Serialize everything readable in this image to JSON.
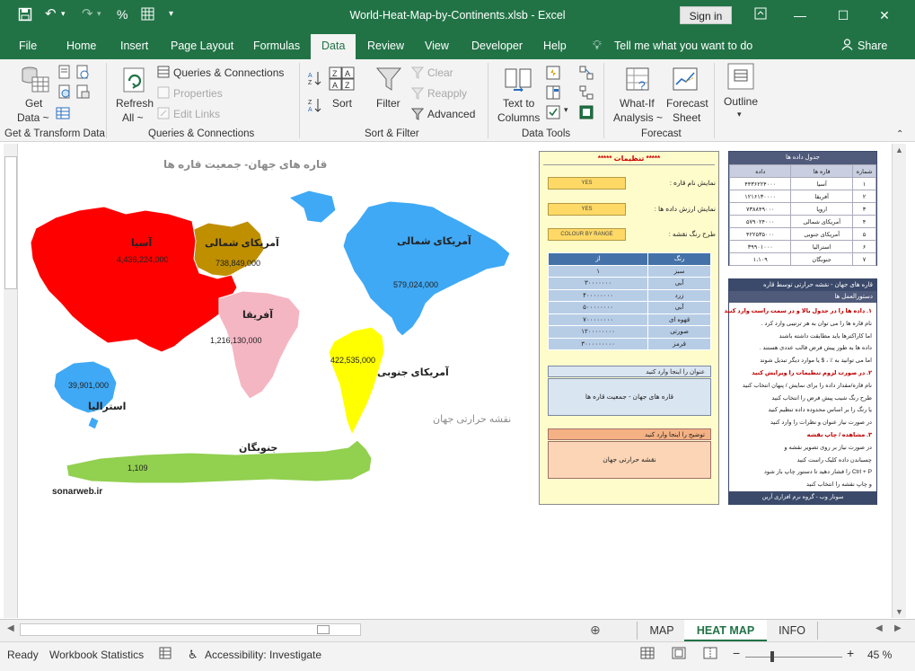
{
  "window": {
    "title": "World-Heat-Map-by-Continents.xlsb  -  Excel",
    "signin_label": "Sign in",
    "colors": {
      "excel_green": "#217346"
    }
  },
  "menu": {
    "tabs": [
      "File",
      "Home",
      "Insert",
      "Page Layout",
      "Formulas",
      "Data",
      "Review",
      "View",
      "Developer",
      "Help"
    ],
    "active_tab": "Data",
    "tell_me": "Tell me what you want to do",
    "share": "Share"
  },
  "ribbon": {
    "get_data": "Get\nData",
    "get_data_l1": "Get",
    "get_data_l2": "Data ~",
    "group_get_transform": "Get & Transform Data",
    "refresh_l1": "Refresh",
    "refresh_l2": "All ~",
    "queries_connections": "Queries & Connections",
    "properties": "Properties",
    "edit_links": "Edit Links",
    "group_queries": "Queries & Connections",
    "sort": "Sort",
    "filter": "Filter",
    "clear": "Clear",
    "reapply": "Reapply",
    "advanced": "Advanced",
    "group_sort_filter": "Sort & Filter",
    "text_to_columns_l1": "Text to",
    "text_to_columns_l2": "Columns",
    "group_data_tools": "Data Tools",
    "whatif_l1": "What-If",
    "whatif_l2": "Analysis ~",
    "forecast_l1": "Forecast",
    "forecast_l2": "Sheet",
    "group_forecast": "Forecast",
    "outline": "Outline"
  },
  "map": {
    "title": "قاره های جهان- جمعیت قاره ها",
    "subtitle": "نقشه حرارتی جهان",
    "watermark": "sonarweb.ir",
    "continents": [
      {
        "key": "asia",
        "name": "آسیا",
        "population": "4,436,224,000",
        "color": "#ff0000"
      },
      {
        "key": "europe",
        "name": "اروپا",
        "population": "738,849,000",
        "color": "#bf8f00"
      },
      {
        "key": "north_america",
        "name": "آمریکای شمالی",
        "population": "579,024,000",
        "color": "#3fa9f5"
      },
      {
        "key": "africa",
        "name": "آفریقا",
        "population": "1,216,130,000",
        "color": "#f4b6c2"
      },
      {
        "key": "south_america",
        "name": "آمریکای جنوبی",
        "population": "422,535,000",
        "color": "#ffff00"
      },
      {
        "key": "australia",
        "name": "استرالیا",
        "population": "39,901,000",
        "color": "#3fa9f5"
      },
      {
        "key": "antarctica",
        "name": "جنوبگان",
        "population": "1,109",
        "color": "#92d050"
      }
    ]
  },
  "settings": {
    "header": "*****   تنظیمات   *****",
    "show_name_label": "نمایش نام قاره :",
    "show_name_value": "YES",
    "show_value_label": "نمایش ارزش داده ها :",
    "show_value_value": "YES",
    "color_scheme_label": "طرح رنگ نقشه :",
    "color_scheme_value": "COLOUR BY RANGE",
    "range_header": {
      "from": "از",
      "color": "رنگ"
    },
    "ranges": [
      {
        "from": "۱",
        "color": "سبز"
      },
      {
        "from": "۳۰۰۰۰۰۰۰",
        "color": "آبی"
      },
      {
        "from": "۴۰۰۰۰۰۰۰۰",
        "color": "زرد"
      },
      {
        "from": "۵۰۰۰۰۰۰۰۰",
        "color": "آبی"
      },
      {
        "from": "۷۰۰۰۰۰۰۰۰",
        "color": "قهوه ای"
      },
      {
        "from": "۱۲۰۰۰۰۰۰۰۰",
        "color": "صورتی"
      },
      {
        "from": "۳۰۰۰۰۰۰۰۰۰",
        "color": "قرمز"
      }
    ],
    "title_box_header": "عنوان را اینجا وارد کنید",
    "title_box_value": "قاره های جهان - جمعیت قاره ها",
    "desc_box_header": "توضیح را اینجا وارد کنید",
    "desc_box_value": "نقشه حرارتی جهان"
  },
  "data_table": {
    "title": "جدول داده ها",
    "headers": {
      "num": "شماره",
      "continent": "قاره ها",
      "data": "داده"
    },
    "rows": [
      {
        "num": "۱",
        "continent": "آسیا",
        "data": "۴۴۳۶۲۲۴۰۰۰"
      },
      {
        "num": "۲",
        "continent": "آفریقا",
        "data": "۱۲۱۶۱۳۰۰۰۰"
      },
      {
        "num": "۳",
        "continent": "اروپا",
        "data": "۷۳۸۸۴۹۰۰۰"
      },
      {
        "num": "۴",
        "continent": "آمریکای شمالی",
        "data": "۵۷۹۰۲۴۰۰۰"
      },
      {
        "num": "۵",
        "continent": "آمریکای جنوبی",
        "data": "۴۲۲۵۳۵۰۰۰"
      },
      {
        "num": "۶",
        "continent": "استرالیا",
        "data": "۳۹۹۰۱۰۰۰"
      },
      {
        "num": "۷",
        "continent": "جنوبگان",
        "data": "۱،۱۰۹"
      }
    ]
  },
  "guide": {
    "title": "قاره های جهان - نقشه حرارتی توسط قاره",
    "subtitle": "دستورالعمل ها",
    "lines": [
      {
        "text": "۱. داده ها را در جدول بالا و در سمت راست وارد کنید",
        "hl": true
      },
      {
        "text": "نام قاره ها را می توان به هر ترتیبی وارد کرد .",
        "hl": false
      },
      {
        "text": "اما کاراکترها باید مطابقت داشته باشند",
        "hl": false
      },
      {
        "text": "داده ها به طور پیش فرض قالب عددی هستند .",
        "hl": false
      },
      {
        "text": "اما می توانید به ٪ ، $ یا موارد دیگر تبدیل شوند",
        "hl": false
      },
      {
        "text": "۲. در صورت لزوم تنظیمات را ویرایش کنید",
        "hl": true
      },
      {
        "text": "نام قاره/مقدار داده را برای نمایش / پنهان انتخاب کنید",
        "hl": false
      },
      {
        "text": "طرح رنگ شیب پیش فرض را انتخاب کنید",
        "hl": false
      },
      {
        "text": "یا رنگ را بر اساس محدوده داده تنظیم کنید",
        "hl": false
      },
      {
        "text": "در صورت نیاز عنوان و نظرات را وارد کنید",
        "hl": false
      },
      {
        "text": "۳. مشاهده / چاپ نقشه",
        "hl": true
      },
      {
        "text": "در صورت نیاز بر روی تصویر نقشه و",
        "hl": false
      },
      {
        "text": "چسباندن داده کلیک راست کنید",
        "hl": false
      },
      {
        "text": "Ctrl + P را فشار دهید تا دستور چاپ باز شود",
        "hl": false
      },
      {
        "text": "و چاپ نقشه را انتخاب کنید",
        "hl": false
      }
    ],
    "footer": "سونار وب  -  گروه نرم افزاری آرین"
  },
  "sheet_tabs": {
    "tabs": [
      "MAP",
      "HEAT MAP",
      "INFO"
    ],
    "active": "HEAT MAP"
  },
  "status": {
    "ready": "Ready",
    "workbook_statistics": "Workbook Statistics",
    "accessibility": "Accessibility: Investigate",
    "zoom": "45 %"
  }
}
